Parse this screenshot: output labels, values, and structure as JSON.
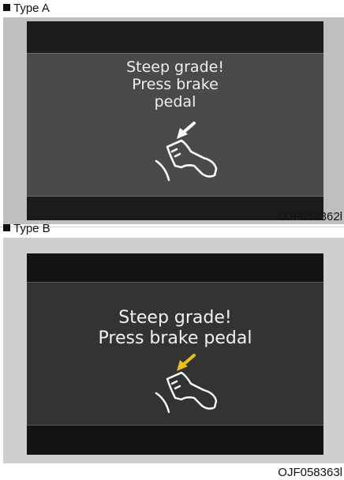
{
  "type_a": {
    "label": "Type A",
    "message_lines": [
      "Steep grade!",
      "Press brake",
      "pedal"
    ],
    "code": "OJF058362l",
    "arrow_color": "#ffffff"
  },
  "type_b": {
    "label": "Type B",
    "message_lines": [
      "Steep grade!",
      "Press brake pedal"
    ],
    "code": "OJF058363l",
    "arrow_color": "#e8c21a"
  },
  "icons": {
    "pedal": "brake-pedal-foot-icon",
    "arrow": "down-left-arrow-icon"
  }
}
